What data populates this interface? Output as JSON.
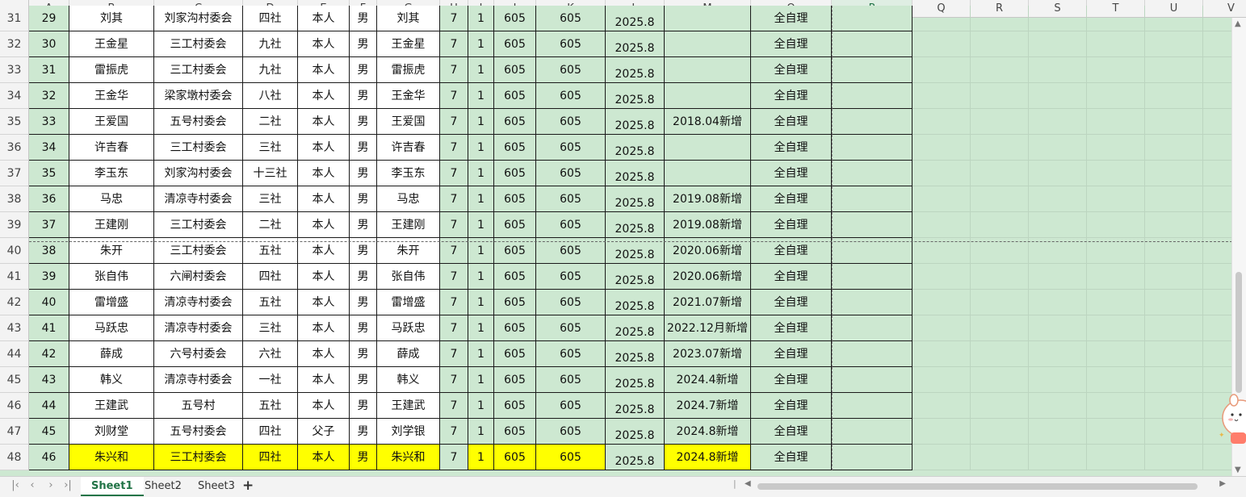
{
  "columns": [
    "A",
    "B",
    "C",
    "D",
    "E",
    "F",
    "G",
    "H",
    "I",
    "J",
    "K",
    "L",
    "M",
    "O",
    "P",
    "Q",
    "R",
    "S",
    "T",
    "U",
    "V"
  ],
  "selected_column": "P",
  "rows": [
    {
      "row": "31",
      "cells": [
        "29",
        "刘其",
        "刘家沟村委会",
        "四社",
        "本人",
        "男",
        "刘其",
        "7",
        "1",
        "605",
        "605",
        "2025.8",
        "",
        "全自理"
      ]
    },
    {
      "row": "32",
      "cells": [
        "30",
        "王金星",
        "三工村委会",
        "九社",
        "本人",
        "男",
        "王金星",
        "7",
        "1",
        "605",
        "605",
        "2025.8",
        "",
        "全自理"
      ]
    },
    {
      "row": "33",
      "cells": [
        "31",
        "雷振虎",
        "三工村委会",
        "九社",
        "本人",
        "男",
        "雷振虎",
        "7",
        "1",
        "605",
        "605",
        "2025.8",
        "",
        "全自理"
      ]
    },
    {
      "row": "34",
      "cells": [
        "32",
        "王金华",
        "梁家墩村委会",
        "八社",
        "本人",
        "男",
        "王金华",
        "7",
        "1",
        "605",
        "605",
        "2025.8",
        "",
        "全自理"
      ]
    },
    {
      "row": "35",
      "cells": [
        "33",
        "王爱国",
        "五号村委会",
        "二社",
        "本人",
        "男",
        "王爱国",
        "7",
        "1",
        "605",
        "605",
        "2025.8",
        "2018.04新增",
        "全自理"
      ]
    },
    {
      "row": "36",
      "cells": [
        "34",
        "许吉春",
        "三工村委会",
        "三社",
        "本人",
        "男",
        "许吉春",
        "7",
        "1",
        "605",
        "605",
        "2025.8",
        "",
        "全自理"
      ]
    },
    {
      "row": "37",
      "cells": [
        "35",
        "李玉东",
        "刘家沟村委会",
        "十三社",
        "本人",
        "男",
        "李玉东",
        "7",
        "1",
        "605",
        "605",
        "2025.8",
        "",
        "全自理"
      ]
    },
    {
      "row": "38",
      "cells": [
        "36",
        "马忠",
        "清凉寺村委会",
        "三社",
        "本人",
        "男",
        "马忠",
        "7",
        "1",
        "605",
        "605",
        "2025.8",
        "2019.08新增",
        "全自理"
      ]
    },
    {
      "row": "39",
      "cells": [
        "37",
        "王建刚",
        "三工村委会",
        "二社",
        "本人",
        "男",
        "王建刚",
        "7",
        "1",
        "605",
        "605",
        "2025.8",
        "2019.08新增",
        "全自理"
      ]
    },
    {
      "row": "40",
      "cells": [
        "38",
        "朱开",
        "三工村委会",
        "五社",
        "本人",
        "男",
        "朱开",
        "7",
        "1",
        "605",
        "605",
        "2025.8",
        "2020.06新增",
        "全自理"
      ]
    },
    {
      "row": "41",
      "cells": [
        "39",
        "张自伟",
        "六闸村委会",
        "四社",
        "本人",
        "男",
        "张自伟",
        "7",
        "1",
        "605",
        "605",
        "2025.8",
        "2020.06新增",
        "全自理"
      ]
    },
    {
      "row": "42",
      "cells": [
        "40",
        "雷增盛",
        "清凉寺村委会",
        "五社",
        "本人",
        "男",
        "雷增盛",
        "7",
        "1",
        "605",
        "605",
        "2025.8",
        "2021.07新增",
        "全自理"
      ]
    },
    {
      "row": "43",
      "cells": [
        "41",
        "马跃忠",
        "清凉寺村委会",
        "三社",
        "本人",
        "男",
        "马跃忠",
        "7",
        "1",
        "605",
        "605",
        "2025.8",
        "2022.12月新增",
        "全自理"
      ]
    },
    {
      "row": "44",
      "cells": [
        "42",
        "薛成",
        "六号村委会",
        "六社",
        "本人",
        "男",
        "薛成",
        "7",
        "1",
        "605",
        "605",
        "2025.8",
        "2023.07新增",
        "全自理"
      ]
    },
    {
      "row": "45",
      "cells": [
        "43",
        "韩义",
        "清凉寺村委会",
        "一社",
        "本人",
        "男",
        "韩义",
        "7",
        "1",
        "605",
        "605",
        "2025.8",
        "2024.4新增",
        "全自理"
      ]
    },
    {
      "row": "46",
      "cells": [
        "44",
        "王建武",
        "五号村",
        "五社",
        "本人",
        "男",
        "王建武",
        "7",
        "1",
        "605",
        "605",
        "2025.8",
        "2024.7新增",
        "全自理"
      ]
    },
    {
      "row": "47",
      "cells": [
        "45",
        "刘财堂",
        "五号村委会",
        "四社",
        "父子",
        "男",
        "刘学银",
        "7",
        "1",
        "605",
        "605",
        "2025.8",
        "2024.8新增",
        "全自理"
      ]
    },
    {
      "row": "48",
      "cells": [
        "46",
        "朱兴和",
        "三工村委会",
        "四社",
        "本人",
        "男",
        "朱兴和",
        "7",
        "1",
        "605",
        "605",
        "2025.8",
        "2024.8新增",
        "全自理"
      ],
      "highlight": true
    }
  ],
  "sheet_tabs": [
    "Sheet1",
    "Sheet2",
    "Sheet3"
  ],
  "active_tab": "Sheet1",
  "add_sheet_label": "+",
  "colors": {
    "grid_green": "#cde8d1",
    "highlight_yellow": "#ffff00",
    "accent": "#217346"
  }
}
